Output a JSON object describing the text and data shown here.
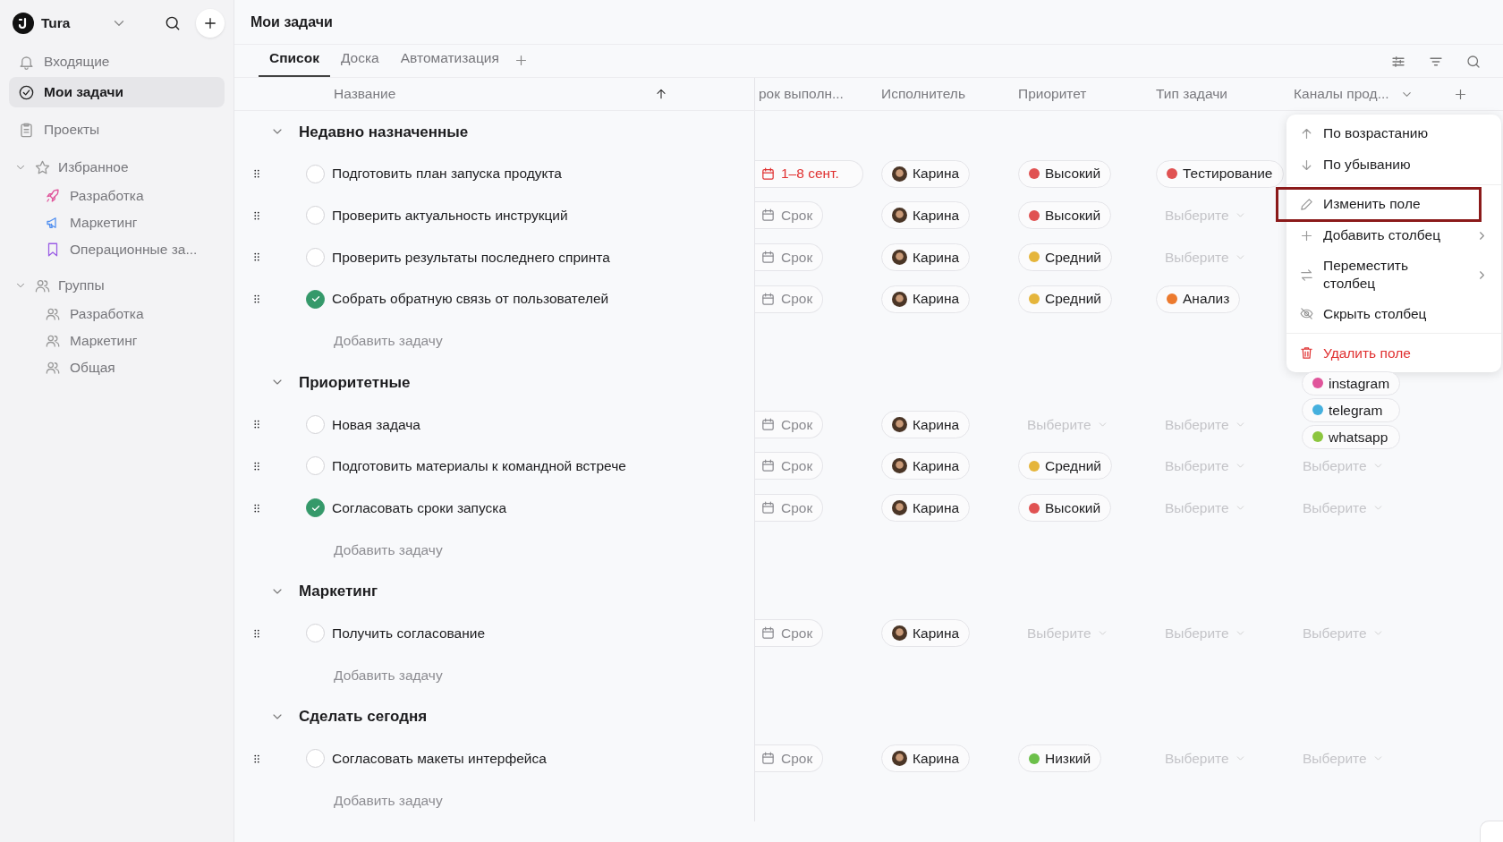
{
  "sidebar": {
    "workspace": "Tura",
    "nav": [
      {
        "label": "Входящие",
        "selected": false
      },
      {
        "label": "Мои задачи",
        "selected": true
      },
      {
        "label": "Проекты",
        "selected": false
      }
    ],
    "sections": [
      {
        "label": "Избранное",
        "expanded": true,
        "children": [
          {
            "label": "Разработка",
            "color": "#e0559b"
          },
          {
            "label": "Маркетинг",
            "color": "#4f8ef0"
          },
          {
            "label": "Операционные за...",
            "color": "#9b5de5"
          }
        ]
      },
      {
        "label": "Группы",
        "expanded": true,
        "children": [
          {
            "label": "Разработка"
          },
          {
            "label": "Маркетинг"
          },
          {
            "label": "Общая"
          }
        ]
      }
    ]
  },
  "page": {
    "title": "Мои задачи"
  },
  "tabs": [
    {
      "label": "Список",
      "selected": true
    },
    {
      "label": "Доска",
      "selected": false
    },
    {
      "label": "Автоматизация",
      "selected": false
    }
  ],
  "columns": [
    {
      "label": "Название",
      "sorted": true,
      "dropdown": false
    },
    {
      "label": "рок выполн...",
      "sorted": false,
      "dropdown": false
    },
    {
      "label": "Исполнитель",
      "sorted": false,
      "dropdown": false
    },
    {
      "label": "Приоритет",
      "sorted": false,
      "dropdown": false
    },
    {
      "label": "Тип задачи",
      "sorted": false,
      "dropdown": false
    },
    {
      "label": "Каналы прод...",
      "sorted": false,
      "dropdown": true
    }
  ],
  "groups": [
    {
      "title": "Недавно назначенные",
      "expanded": true,
      "add_label": "Добавить задачу",
      "tasks": [
        {
          "title": "Подготовить план запуска продукта",
          "done": false,
          "due": {
            "text": "1–8 сент.",
            "overdue": true
          },
          "assignee": "Карина",
          "priority": {
            "tags": [
              {
                "text": "Высокий",
                "color": "#e05252"
              }
            ]
          },
          "type": {
            "tags": [
              {
                "text": "Тестирование",
                "color": "#e05252"
              }
            ]
          }
        },
        {
          "title": "Проверить актуальность инструкций",
          "done": false,
          "due": {
            "text": "Срок",
            "overdue": false
          },
          "assignee": "Карина",
          "priority": {
            "tags": [
              {
                "text": "Высокий",
                "color": "#e05252"
              }
            ]
          },
          "type": {
            "placeholder": "Выберите"
          }
        },
        {
          "title": "Проверить результаты последнего спринта",
          "done": false,
          "due": {
            "text": "Срок",
            "overdue": false
          },
          "assignee": "Карина",
          "priority": {
            "tags": [
              {
                "text": "Средний",
                "color": "#e5b53b"
              }
            ]
          },
          "type": {
            "placeholder": "Выберите"
          }
        },
        {
          "title": "Собрать обратную связь от пользователей",
          "done": true,
          "due": {
            "text": "Срок",
            "overdue": false
          },
          "assignee": "Карина",
          "priority": {
            "tags": [
              {
                "text": "Средний",
                "color": "#e5b53b"
              }
            ]
          },
          "type": {
            "tags": [
              {
                "text": "Анализ",
                "color": "#ec7a2e"
              }
            ]
          }
        }
      ]
    },
    {
      "title": "Приоритетные",
      "expanded": true,
      "add_label": "Добавить задачу",
      "tasks": [
        {
          "title": "Новая задача",
          "done": false,
          "due": {
            "text": "Срок",
            "overdue": false
          },
          "assignee": "Карина",
          "priority": {
            "placeholder": "Выберите"
          },
          "type": {
            "placeholder": "Выберите"
          },
          "channels": {
            "tags": [
              {
                "text": "instagram",
                "color": "#e0559b"
              },
              {
                "text": "telegram",
                "color": "#45b0de"
              },
              {
                "text": "whatsapp",
                "color": "#8cc63f"
              }
            ]
          }
        },
        {
          "title": "Подготовить материалы к командной встрече",
          "done": false,
          "due": {
            "text": "Срок",
            "overdue": false
          },
          "assignee": "Карина",
          "priority": {
            "tags": [
              {
                "text": "Средний",
                "color": "#e5b53b"
              }
            ]
          },
          "type": {
            "placeholder": "Выберите"
          },
          "channels": {
            "placeholder": "Выберите"
          }
        },
        {
          "title": "Согласовать сроки запуска",
          "done": true,
          "due": {
            "text": "Срок",
            "overdue": false
          },
          "assignee": "Карина",
          "priority": {
            "tags": [
              {
                "text": "Высокий",
                "color": "#e05252"
              }
            ]
          },
          "type": {
            "placeholder": "Выберите"
          },
          "channels": {
            "placeholder": "Выберите"
          }
        }
      ]
    },
    {
      "title": "Маркетинг",
      "expanded": true,
      "add_label": "Добавить задачу",
      "tasks": [
        {
          "title": "Получить согласование",
          "done": false,
          "due": {
            "text": "Срок",
            "overdue": false
          },
          "assignee": "Карина",
          "priority": {
            "placeholder": "Выберите"
          },
          "type": {
            "placeholder": "Выберите"
          },
          "channels": {
            "placeholder": "Выберите"
          }
        }
      ]
    },
    {
      "title": "Сделать сегодня",
      "expanded": true,
      "add_label": "Добавить задачу",
      "tasks": [
        {
          "title": "Согласовать макеты интерфейса",
          "done": false,
          "due": {
            "text": "Срок",
            "overdue": false
          },
          "assignee": "Карина",
          "priority": {
            "tags": [
              {
                "text": "Низкий",
                "color": "#6cc04a"
              }
            ]
          },
          "type": {
            "placeholder": "Выберите"
          },
          "channels": {
            "placeholder": "Выберите"
          }
        }
      ]
    }
  ],
  "menu": {
    "sections": [
      [
        {
          "label": "По возрастанию",
          "kind": "normal",
          "highlighted": false,
          "submenu": false
        },
        {
          "label": "По убыванию",
          "kind": "normal",
          "highlighted": false,
          "submenu": false
        }
      ],
      [
        {
          "label": "Изменить поле",
          "kind": "normal",
          "highlighted": true,
          "submenu": false
        },
        {
          "label": "Добавить столбец",
          "kind": "normal",
          "highlighted": false,
          "submenu": true
        },
        {
          "label": "Переместить столбец",
          "kind": "normal",
          "highlighted": false,
          "submenu": true
        },
        {
          "label": "Скрыть столбец",
          "kind": "normal",
          "highlighted": false,
          "submenu": false
        }
      ],
      [
        {
          "label": "Удалить поле",
          "kind": "danger",
          "highlighted": false,
          "submenu": false
        }
      ]
    ]
  }
}
